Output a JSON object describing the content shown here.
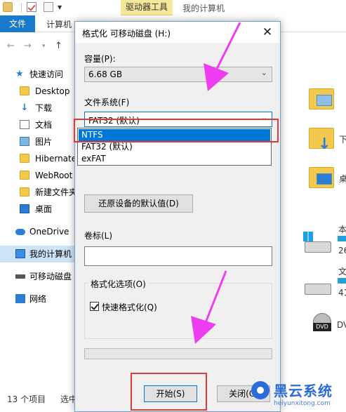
{
  "explorer": {
    "ribbon_context_tab": "驱动器工具",
    "ribbon_context_title": "我的计算机",
    "tab_file": "文件",
    "tab_computer": "计算机",
    "sidebar": [
      {
        "label": "快速访问",
        "icon": "star-icon"
      },
      {
        "label": "Desktop",
        "icon": "folder-icon"
      },
      {
        "label": "下载",
        "icon": "download-icon"
      },
      {
        "label": "文档",
        "icon": "document-icon"
      },
      {
        "label": "图片",
        "icon": "pictures-icon"
      },
      {
        "label": "Hibernate",
        "icon": "folder-icon"
      },
      {
        "label": "WebRoot",
        "icon": "folder-icon"
      },
      {
        "label": "新建文件夹",
        "icon": "folder-icon"
      },
      {
        "label": "桌面",
        "icon": "desktop-icon"
      },
      {
        "label": "OneDrive",
        "icon": "cloud-icon"
      },
      {
        "label": "我的计算机",
        "icon": "computer-icon"
      },
      {
        "label": "可移动磁盘",
        "icon": "usb-drive-icon"
      },
      {
        "label": "网络",
        "icon": "network-icon"
      }
    ],
    "right_labels": {
      "downloads": "下",
      "desktop": "桌",
      "drive_c": "本",
      "drive_c_size": "26",
      "drive_d": "文",
      "drive_d_size": "41",
      "dvd": "DV",
      "dvd_badge": "DVD"
    },
    "status_count": "13 个项目",
    "status_selected": "选中"
  },
  "dialog": {
    "title": "格式化 可移动磁盘 (H:)",
    "capacity_label": "容量(P):",
    "capacity_value": "6.68 GB",
    "filesystem_label": "文件系统(F)",
    "filesystem_value": "FAT32 (默认)",
    "filesystem_options": [
      "NTFS",
      "FAT32 (默认)",
      "exFAT"
    ],
    "filesystem_highlighted": "NTFS",
    "restore_defaults": "还原设备的默认值(D)",
    "volume_label": "卷标(L)",
    "volume_value": "",
    "format_options_title": "格式化选项(O)",
    "quick_format_label": "快速格式化(Q)",
    "quick_format_checked": true,
    "progress": 0,
    "start_button": "开始(S)",
    "close_button": "关闭(C)"
  },
  "annotations": {
    "arrow_color": "#ee3df0",
    "box_color": "#e23a3a"
  },
  "watermark": {
    "brand": "黑云系统",
    "url": "heiyunxitong.com"
  }
}
